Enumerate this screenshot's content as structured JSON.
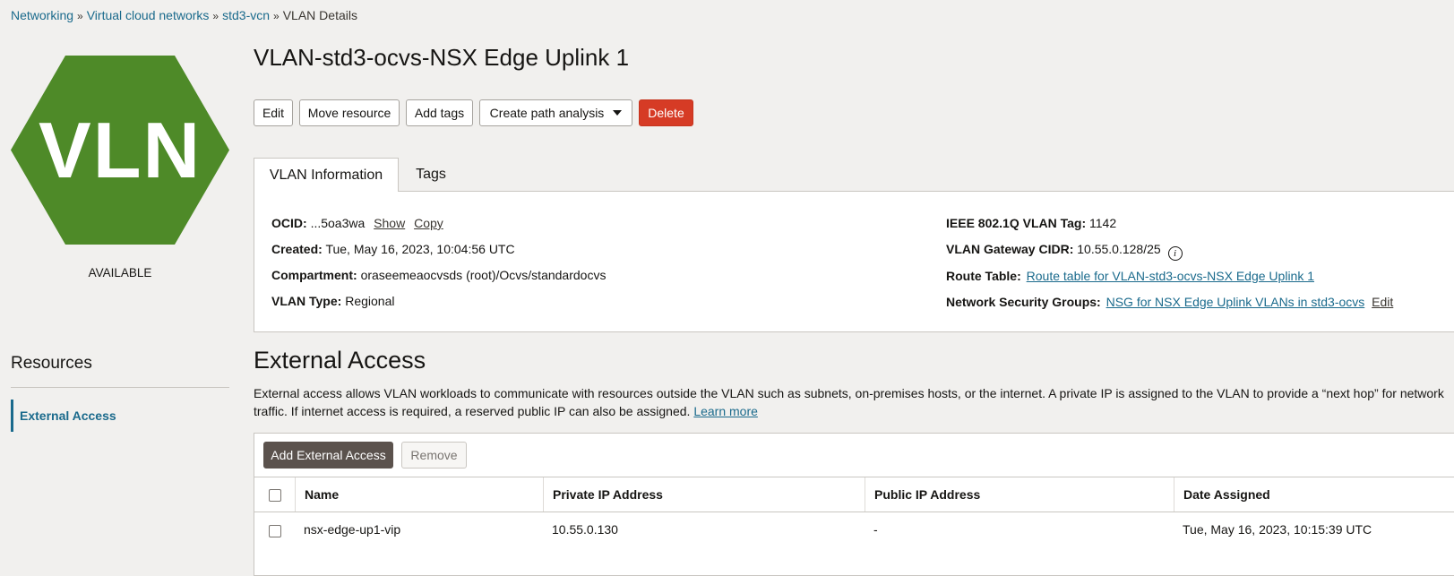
{
  "breadcrumb": {
    "items": [
      "Networking",
      "Virtual cloud networks",
      "std3-vcn"
    ],
    "current": "VLAN Details",
    "separator": "»"
  },
  "resource_icon": {
    "text": "VLN",
    "color": "#4e8a28"
  },
  "status": "AVAILABLE",
  "page_title": "VLAN-std3-ocvs-NSX Edge Uplink 1",
  "actions": {
    "edit": "Edit",
    "move": "Move resource",
    "add_tags": "Add tags",
    "path_analysis": "Create path analysis",
    "delete": "Delete"
  },
  "tabs": {
    "info": "VLAN Information",
    "tags": "Tags"
  },
  "info": {
    "ocid_label": "OCID:",
    "ocid_value": "...5oa3wa",
    "ocid_show": "Show",
    "ocid_copy": "Copy",
    "created_label": "Created:",
    "created_value": "Tue, May 16, 2023, 10:04:56 UTC",
    "compartment_label": "Compartment:",
    "compartment_value": "oraseemeaocvsds (root)/Ocvs/standardocvs",
    "type_label": "VLAN Type:",
    "type_value": "Regional",
    "tag_label": "IEEE 802.1Q VLAN Tag:",
    "tag_value": "1142",
    "gw_label": "VLAN Gateway CIDR:",
    "gw_value": "10.55.0.128/25",
    "route_label": "Route Table:",
    "route_value": "Route table for VLAN-std3-ocvs-NSX Edge Uplink 1",
    "nsg_label": "Network Security Groups:",
    "nsg_value": "NSG for NSX Edge Uplink VLANs in std3-ocvs",
    "nsg_edit": "Edit"
  },
  "resources": {
    "title": "Resources",
    "items": [
      "External Access"
    ]
  },
  "external_access": {
    "title": "External Access",
    "description": "External access allows VLAN workloads to communicate with resources outside the VLAN such as subnets, on-premises hosts, or the internet. A private IP is assigned to the VLAN to provide a “next hop” for network traffic. If internet access is required, a reserved public IP can also be assigned.",
    "learn_more": "Learn more",
    "add_button": "Add External Access",
    "remove_button": "Remove",
    "columns": [
      "Name",
      "Private IP Address",
      "Public IP Address",
      "Date Assigned"
    ],
    "rows": [
      {
        "name": "nsx-edge-up1-vip",
        "private_ip": "10.55.0.130",
        "public_ip": "-",
        "date": "Tue, May 16, 2023, 10:15:39 UTC"
      }
    ]
  }
}
